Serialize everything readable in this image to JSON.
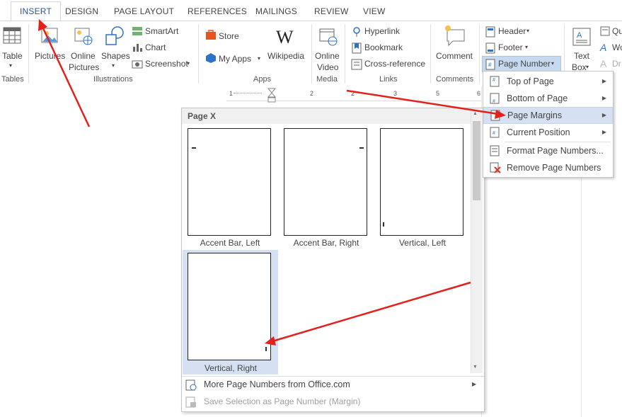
{
  "tabs": [
    "INSERT",
    "DESIGN",
    "PAGE LAYOUT",
    "REFERENCES",
    "MAILINGS",
    "REVIEW",
    "VIEW"
  ],
  "groups": {
    "tables": {
      "label": "Tables",
      "table": "Table"
    },
    "illustrations": {
      "label": "Illustrations",
      "pictures": "Pictures",
      "online_pictures_1": "Online",
      "online_pictures_2": "Pictures",
      "shapes": "Shapes",
      "smartart": "SmartArt",
      "chart": "Chart",
      "screenshot": "Screenshot"
    },
    "apps": {
      "label": "Apps",
      "store": "Store",
      "my_apps": "My Apps",
      "wikipedia": "Wikipedia"
    },
    "media": {
      "label": "Media",
      "online_video_1": "Online",
      "online_video_2": "Video"
    },
    "links": {
      "label": "Links",
      "hyperlink": "Hyperlink",
      "bookmark": "Bookmark",
      "cross_reference": "Cross-reference"
    },
    "comments": {
      "label": "Comments",
      "comment": "Comment"
    },
    "header_footer": {
      "header": "Header",
      "footer": "Footer",
      "page_number": "Page Number"
    },
    "text": {
      "text_box_1": "Text",
      "text_box_2": "Box",
      "qu": "Qu",
      "wo": "Wo",
      "dr": "Dr"
    }
  },
  "ruler": [
    "1",
    "2",
    "1",
    "2",
    "3",
    "4",
    "5",
    "6"
  ],
  "page_number_menu": {
    "items": [
      "Top of Page",
      "Bottom of Page",
      "Page Margins",
      "Current Position",
      "Format Page Numbers...",
      "Remove Page Numbers"
    ]
  },
  "gallery": {
    "header": "Page X",
    "items": [
      "Accent Bar, Left",
      "Accent Bar, Right",
      "Vertical, Left",
      "Vertical, Right"
    ],
    "more": "More Page Numbers from Office.com",
    "save": "Save Selection as Page Number (Margin)"
  },
  "colors": {
    "accent": "#2b579a",
    "hover": "#d5e1f2",
    "arrow": "#e5201b"
  }
}
